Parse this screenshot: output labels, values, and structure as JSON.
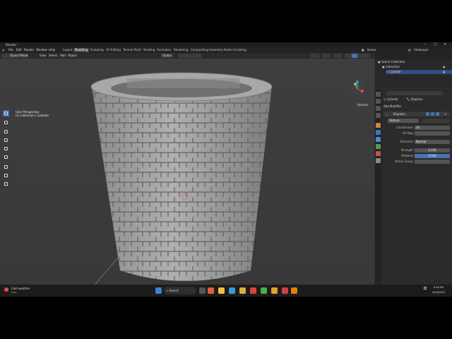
{
  "window": {
    "title": "Blender"
  },
  "menu": [
    "File",
    "Edit",
    "Render",
    "Window",
    "Help"
  ],
  "workspaces": [
    "Layout",
    "Modeling",
    "Sculpting",
    "UV Editing",
    "Texture Paint",
    "Shading",
    "Animation",
    "Rendering",
    "Compositing",
    "Geometry Nodes",
    "Scripting"
  ],
  "active_workspace": "Modeling",
  "scene": {
    "scene_label": "Scene",
    "view_layer": "ViewLayer"
  },
  "viewport_header": {
    "mode": "Object Mode",
    "view": "View",
    "select": "Select",
    "add": "Add",
    "object": "Object",
    "orientation": "Global",
    "options": "Options"
  },
  "viewport": {
    "perspective": "User Perspective",
    "collection": "(1) Collection | Cylinder"
  },
  "outliner": {
    "root": "Scene Collection",
    "collection": "Collection",
    "object": "Cylinder"
  },
  "properties": {
    "breadcrumb_object": "Cylinder",
    "breadcrumb_modifier": "Displace",
    "add_modifier": "Add Modifier",
    "modifier_name": "Displace",
    "texture": "Texture",
    "coordinates_label": "Coordinates",
    "coordinates_value": "UV",
    "uvmap_label": "UV Map",
    "direction_label": "Direction",
    "direction_value": "Normal",
    "strength_label": "Strength",
    "strength_value": "0.100",
    "midlevel_label": "Midlevel",
    "midlevel_value": "0.500",
    "vertex_group_label": "Vertex Group"
  },
  "status": {
    "left1": "Control",
    "left2": "Auto Keys",
    "version": "4.0.1"
  },
  "taskbar": {
    "weather_title": "Cold weather",
    "weather_sub": "Now",
    "search": "Search",
    "time": "6:46 PM",
    "date": "4/24/2024"
  },
  "colors": {
    "accent": "#4772b3",
    "viewport_bg": "#3d3d3d",
    "stone": "#9a9a9a"
  }
}
